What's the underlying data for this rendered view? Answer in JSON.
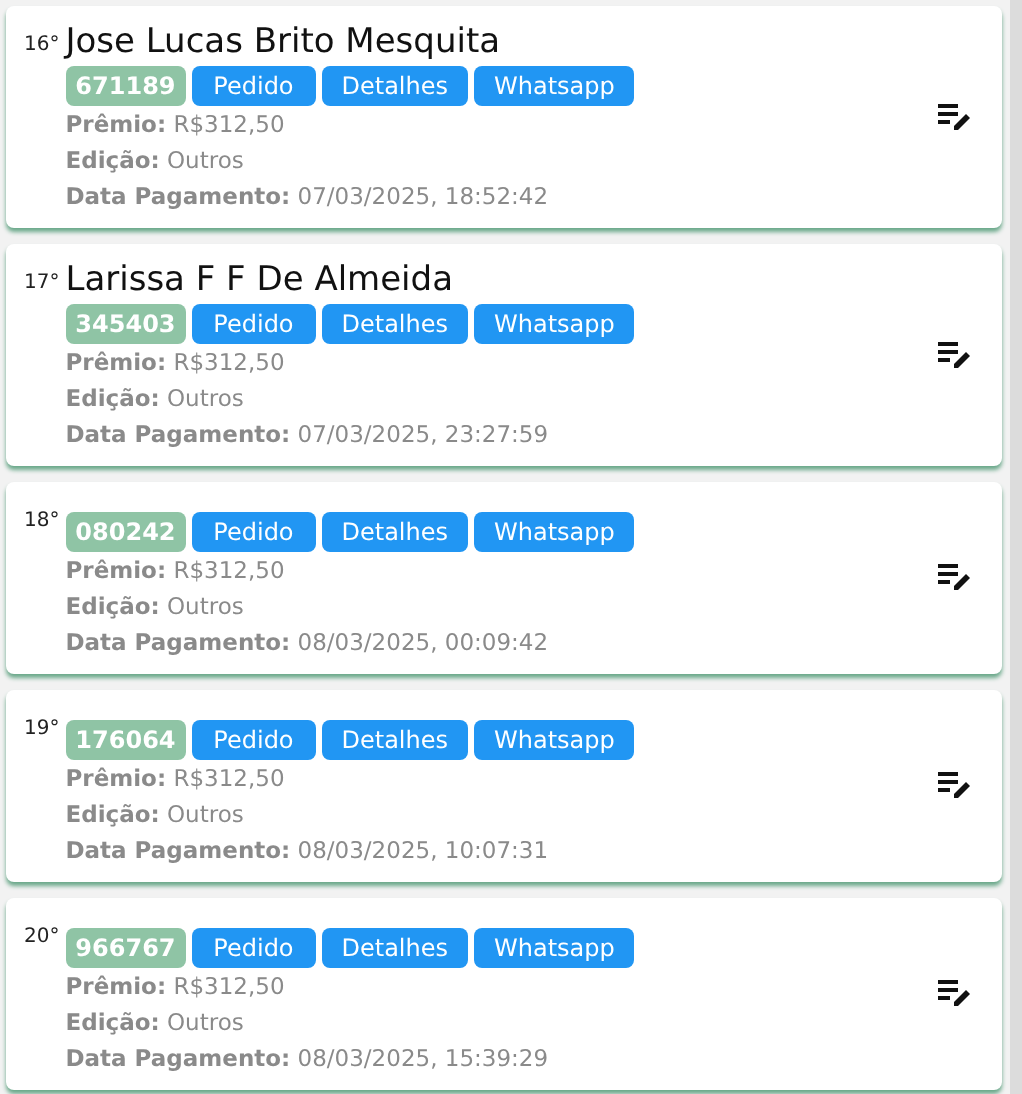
{
  "entries": [
    {
      "rank": "16°",
      "name": "Jose Lucas Brito Mesquita",
      "code": "671189",
      "buttons": [
        "Pedido",
        "Detalhes",
        "Whatsapp"
      ],
      "details": [
        "**Prêmio:** R$312,50",
        "**Edição:** Outros",
        "**Data Pagamento:** 07/03/2025, 18:52:42"
      ]
    },
    {
      "rank": "17°",
      "name": "Larissa F F De Almeida",
      "code": "345403",
      "buttons": [
        "Pedido",
        "Detalhes",
        "Whatsapp"
      ],
      "details": [
        "**Prêmio:** R$312,50",
        "**Edição:** Outros",
        "**Data Pagamento:** 07/03/2025, 23:27:59"
      ]
    },
    {
      "rank": "18°",
      "code": "080242",
      "buttons": [
        "Pedido",
        "Detalhes",
        "Whatsapp"
      ],
      "details": [
        "**Prêmio:** R$312,50",
        "**Edição:** Outros",
        "**Data Pagamento:** 08/03/2025, 00:09:42"
      ]
    },
    {
      "rank": "19°",
      "code": "176064",
      "buttons": [
        "Pedido",
        "Detalhes",
        "Whatsapp"
      ],
      "details": [
        "**Prêmio:** R$312,50",
        "**Edição:** Outros",
        "**Data Pagamento:** 08/03/2025, 10:07:31"
      ]
    },
    {
      "rank": "20°",
      "code": "966767",
      "buttons": [
        "Pedido",
        "Detalhes",
        "Whatsapp"
      ],
      "details": [
        "**Prêmio:** R$312,50",
        "**Edição:** Outros",
        "**Data Pagamento:** 08/03/2025, 15:39:29"
      ]
    }
  ]
}
